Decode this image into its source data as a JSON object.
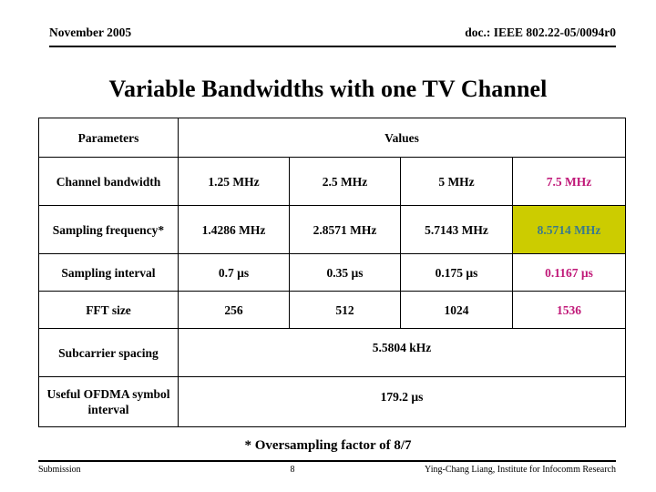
{
  "header": {
    "date": "November 2005",
    "doc_id": "doc.: IEEE 802.22-05/0094r0"
  },
  "title": "Variable Bandwidths with one TV Channel",
  "table": {
    "col_header_parameters": "Parameters",
    "col_header_values": "Values",
    "rows": [
      {
        "parameter": "Channel bandwidth",
        "values": [
          "1.25 MHz",
          "2.5 MHz",
          "5 MHz",
          "7.5 MHz"
        ]
      },
      {
        "parameter": "Sampling frequency*",
        "values": [
          "1.4286 MHz",
          "2.8571 MHz",
          "5.7143 MHz",
          "8.5714 MHz"
        ]
      },
      {
        "parameter": "Sampling interval",
        "values": [
          "0.7 µs",
          "0.35 µs",
          "0.175 µs",
          "0.1167 µs"
        ]
      },
      {
        "parameter": "FFT size",
        "values": [
          "256",
          "512",
          "1024",
          "1536"
        ]
      }
    ],
    "merged_rows": [
      {
        "parameter": "Subcarrier spacing",
        "value": "5.5804 kHz"
      },
      {
        "parameter": "Useful OFDMA symbol interval",
        "value": "179.2 µs"
      }
    ]
  },
  "footnote": "* Oversampling factor of 8/7",
  "footer": {
    "left": "Submission",
    "page": "8",
    "right": "Ying-Chang Liang, Institute for Infocomm Research"
  },
  "colors": {
    "accent_magenta": "#c01878",
    "highlight_olive": "#cccc00",
    "highlight_text_teal": "#3a7a8c",
    "rule": "#000000"
  }
}
